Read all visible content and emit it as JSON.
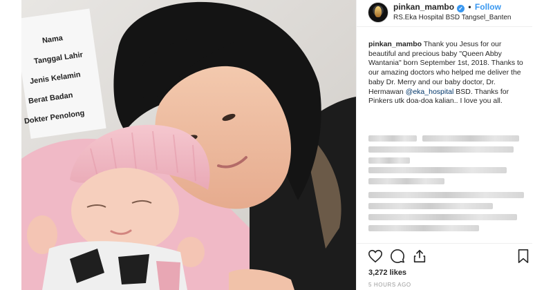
{
  "post": {
    "username": "pinkan_mambo",
    "separator": "•",
    "follow_label": "Follow",
    "location": "RS.Eka Hospital BSD Tangsel_Banten",
    "verified": true
  },
  "caption": {
    "username": "pinkan_mambo",
    "text_1": " Thank you Jesus for our beautiful and precious baby \"Queen Abby Wantania\" born September 1st, 2018. Thanks to our amazing doctors who helped me deliver the baby Dr. Merry and our baby doctor, Dr. Hermawan ",
    "mention": "@eka_hospital",
    "text_2": " BSD. Thanks for Pinkers utk doa-doa kalian.. I love you all."
  },
  "photo_sign": {
    "line1": "Nama",
    "line2": "Tanggal Lahir",
    "line3": "Jenis Kelamin",
    "line4": "Berat Badan",
    "line5": "Dokter Penolong"
  },
  "stats": {
    "likes": "3,272 likes",
    "time": "5 HOURS AGO"
  },
  "icons": {
    "like": "heart-icon",
    "comment": "comment-icon",
    "share": "share-icon",
    "save": "bookmark-icon"
  },
  "colors": {
    "link": "#3897f0",
    "mention": "#003569",
    "muted": "#999999",
    "text": "#262626"
  }
}
